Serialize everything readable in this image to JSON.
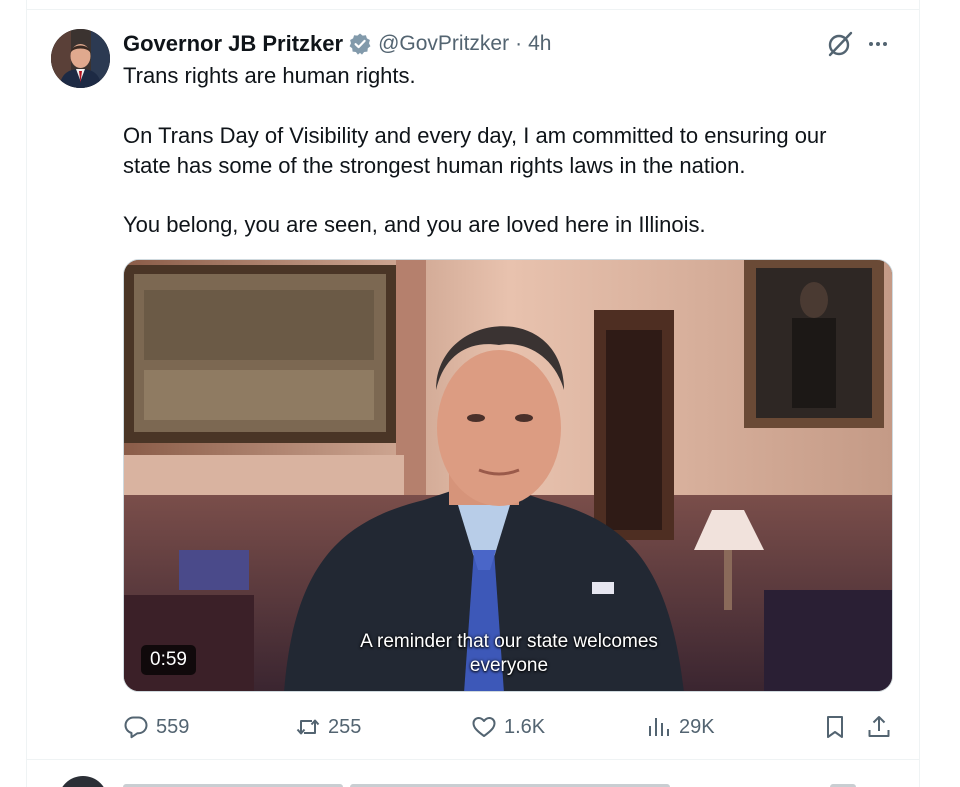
{
  "tweet": {
    "display_name": "Governor JB Pritzker",
    "handle": "@GovPritzker",
    "separator": "·",
    "time": "4h",
    "paragraphs": [
      [
        "Trans rights are human rights."
      ],
      [
        "On Trans Day of Visibility and every day, I am committed to ensuring our",
        "state has some of the strongest human rights laws in the nation."
      ],
      [
        "You belong, you are seen, and you are loved here in Illinois."
      ]
    ],
    "video": {
      "caption_line1": "A reminder that our state welcomes",
      "caption_line2": "everyone",
      "duration": "0:59"
    },
    "actions": {
      "replies": "559",
      "reposts": "255",
      "likes": "1.6K",
      "views": "29K"
    }
  },
  "icons": {
    "verified": "verified-badge-icon",
    "grok": "grok-icon",
    "more": "more-icon",
    "reply": "reply-icon",
    "repost": "repost-icon",
    "like": "like-icon",
    "views": "views-icon",
    "bookmark": "bookmark-icon",
    "share": "share-icon"
  },
  "colors": {
    "text": "#0f1419",
    "secondary": "#536471",
    "verified_badge": "#829aab",
    "border": "#eff3f4"
  }
}
